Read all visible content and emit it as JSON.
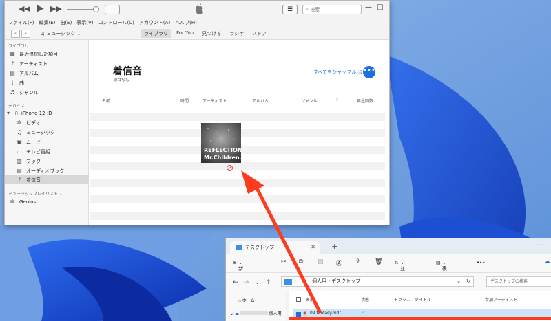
{
  "itunes": {
    "search_placeholder": "検索",
    "menu": [
      "ファイル(F)",
      "編集(E)",
      "曲(S)",
      "表示(V)",
      "コントロール(C)",
      "アカウント(A)",
      "ヘルプ(H)"
    ],
    "media_selector": "ミュージック",
    "tabs": [
      {
        "label": "ライブラリ",
        "active": true
      },
      {
        "label": "For You",
        "active": false
      },
      {
        "label": "見つける",
        "active": false
      },
      {
        "label": "ラジオ",
        "active": false
      },
      {
        "label": "ストア",
        "active": false
      }
    ],
    "sidebar": {
      "library_title": "ライブラリ",
      "library_items": [
        {
          "label": "最近追加した項目",
          "icon": "recent-icon"
        },
        {
          "label": "アーティスト",
          "icon": "artist-icon"
        },
        {
          "label": "アルバム",
          "icon": "album-icon"
        },
        {
          "label": "曲",
          "icon": "note-icon"
        },
        {
          "label": "ジャンル",
          "icon": "genre-icon"
        }
      ],
      "devices_title": "デバイス",
      "device_name": "iPhone 12 :D",
      "device_items": [
        {
          "label": "ビデオ",
          "icon": "video-icon"
        },
        {
          "label": "ミュージック",
          "icon": "music-icon"
        },
        {
          "label": "ムービー",
          "icon": "movie-icon"
        },
        {
          "label": "テレビ番組",
          "icon": "tv-icon"
        },
        {
          "label": "ブック",
          "icon": "book-icon"
        },
        {
          "label": "オーディオブック",
          "icon": "audiobook-icon"
        },
        {
          "label": "着信音",
          "icon": "bell-icon"
        }
      ],
      "playlists_title": "ミュージックプレイリスト",
      "playlist_items": [
        {
          "label": "Genius",
          "icon": "genius-icon"
        }
      ]
    },
    "content": {
      "title": "着信音",
      "subtitle": "項目なし",
      "shuffle_label": "すべてをシャッフル",
      "more_label": "•••",
      "columns": [
        "名前",
        "時間",
        "アーティスト",
        "アルバム",
        "ジャンル",
        "♡",
        "再生回数"
      ],
      "album_art": {
        "line1": "REFLECTION",
        "line2": "Mr.Children."
      }
    }
  },
  "explorer": {
    "tab_title": "デスクトップ",
    "new_label": "新規作成",
    "sort_label": "並べ替え",
    "view_label": "表示",
    "more_label": "•••",
    "address_path": [
      "個人用",
      "デスクトップ"
    ],
    "search_placeholder": "デスクトップの検索",
    "sidebar": [
      {
        "label": "ホーム"
      },
      {
        "label": "個人用"
      }
    ],
    "columns": [
      "名前",
      "状態",
      "トラッ...",
      "タイトル",
      "参加アーティスト"
    ],
    "file": {
      "name": "09 fantasy.m4r",
      "status": "✓"
    }
  },
  "colors": {
    "accent": "#1e6fe0",
    "arrow": "#ff3b1f",
    "selection": "#cce4f7"
  }
}
